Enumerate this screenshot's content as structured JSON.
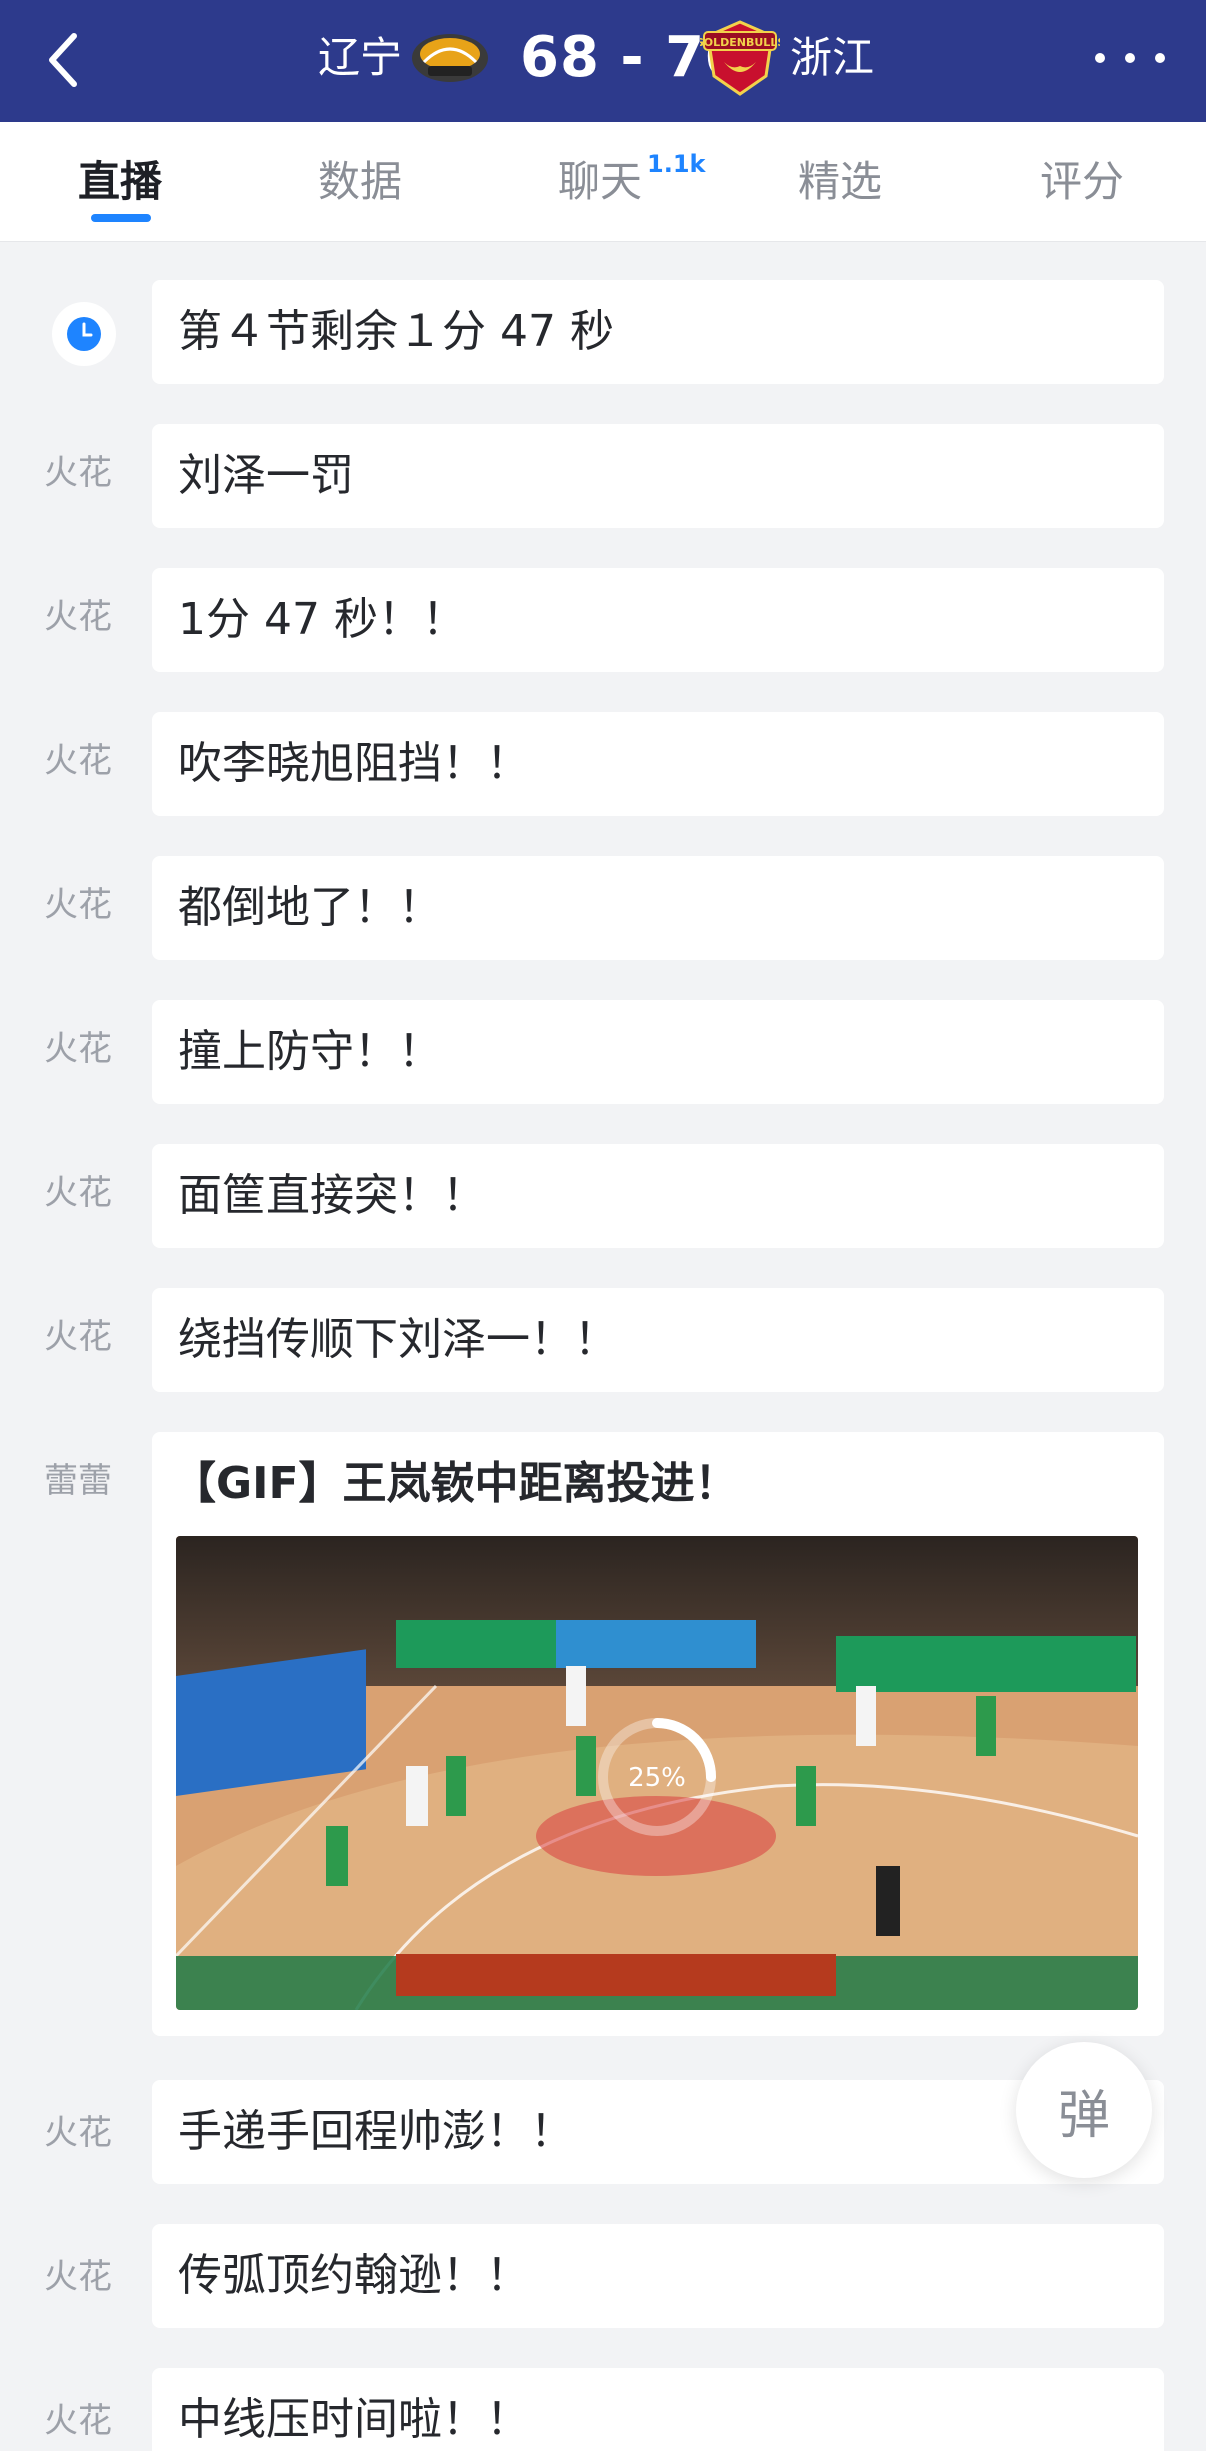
{
  "header": {
    "back_icon": "chevron-left-icon",
    "team_left": "辽宁",
    "team_left_logo": "liaoning-logo",
    "score": "68 - 70",
    "team_right_logo": "zhejiang-golden-bulls-logo",
    "team_right_logo_text": "GOLDENBULLS",
    "team_right": "浙江",
    "more_icon": "more-dots-icon",
    "bg_color": "#2d3a8c"
  },
  "tabs": [
    {
      "label": "直播",
      "active": true
    },
    {
      "label": "数据",
      "active": false
    },
    {
      "label": "聊天",
      "active": false,
      "badge": "1.1k"
    },
    {
      "label": "精选",
      "active": false
    },
    {
      "label": "评分",
      "active": false
    }
  ],
  "accent_color": "#1e84ff",
  "feed": [
    {
      "author": "",
      "icon": "clock-icon",
      "text": "第４节剩余１分 47 秒"
    },
    {
      "author": "火花",
      "text": "刘泽一罚"
    },
    {
      "author": "火花",
      "text": "1分 47 秒！！"
    },
    {
      "author": "火花",
      "text": "吹李晓旭阻挡！！"
    },
    {
      "author": "火花",
      "text": "都倒地了！！"
    },
    {
      "author": "火花",
      "text": "撞上防守！！"
    },
    {
      "author": "火花",
      "text": "面筐直接突！！"
    },
    {
      "author": "火花",
      "text": "绕挡传顺下刘泽一！！"
    },
    {
      "author": "蕾蕾",
      "text": "【GIF】王岚嵚中距离投进！",
      "media": {
        "type": "gif",
        "loading_progress": 0.25,
        "progress_label": "25%"
      }
    },
    {
      "author": "火花",
      "text": "手递手回程帅澎！！"
    },
    {
      "author": "火花",
      "text": "传弧顶约翰逊！！"
    },
    {
      "author": "火花",
      "text": "中线压时间啦！！"
    }
  ],
  "danmu_button": "弹"
}
